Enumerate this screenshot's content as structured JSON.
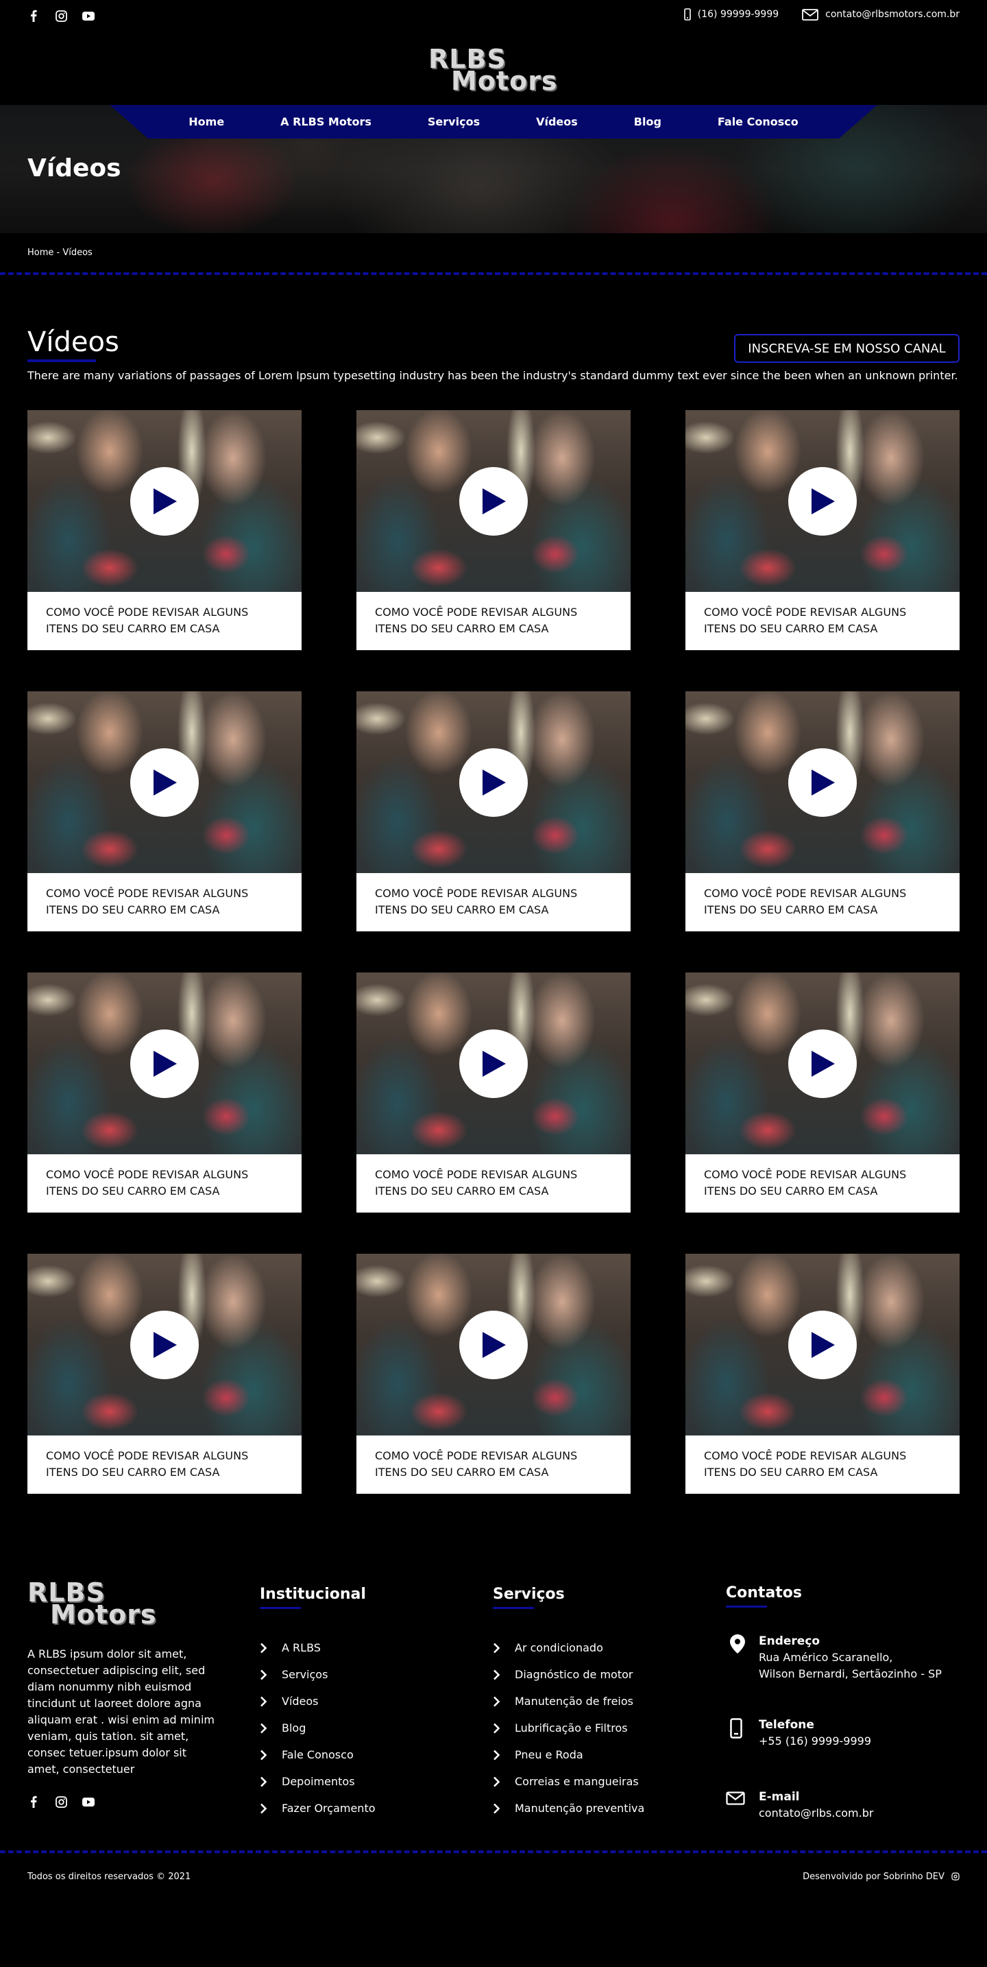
{
  "topbar": {
    "phone": "(16) 99999-9999",
    "email": "contato@rlbsmotors.com.br",
    "social_icons": [
      "facebook-icon",
      "instagram-icon",
      "youtube-icon"
    ]
  },
  "brand": {
    "line1": "RLBS",
    "line2": "Motors"
  },
  "nav": [
    "Home",
    "A RLBS Motors",
    "Serviços",
    "Vídeos",
    "Blog",
    "Fale Conosco"
  ],
  "hero": {
    "title": "Vídeos"
  },
  "breadcrumb": "Home - Vídeos",
  "section": {
    "title": "Vídeos",
    "subscribe_label": "INSCREVA-SE EM NOSSO CANAL",
    "intro": "There are many variations of passages of Lorem Ipsum typesetting industry has been the industry's standard dummy text ever since the been when an unknown printer."
  },
  "videos": [
    {
      "title": "COMO VOCÊ PODE REVISAR ALGUNS ITENS DO SEU CARRO EM CASA"
    },
    {
      "title": "COMO VOCÊ PODE REVISAR ALGUNS ITENS DO SEU CARRO EM CASA"
    },
    {
      "title": "COMO VOCÊ PODE REVISAR ALGUNS ITENS DO SEU CARRO EM CASA"
    },
    {
      "title": "COMO VOCÊ PODE REVISAR ALGUNS ITENS DO SEU CARRO EM CASA"
    },
    {
      "title": "COMO VOCÊ PODE REVISAR ALGUNS ITENS DO SEU CARRO EM CASA"
    },
    {
      "title": "COMO VOCÊ PODE REVISAR ALGUNS ITENS DO SEU CARRO EM CASA"
    },
    {
      "title": "COMO VOCÊ PODE REVISAR ALGUNS ITENS DO SEU CARRO EM CASA"
    },
    {
      "title": "COMO VOCÊ PODE REVISAR ALGUNS ITENS DO SEU CARRO EM CASA"
    },
    {
      "title": "COMO VOCÊ PODE REVISAR ALGUNS ITENS DO SEU CARRO EM CASA"
    },
    {
      "title": "COMO VOCÊ PODE REVISAR ALGUNS ITENS DO SEU CARRO EM CASA"
    },
    {
      "title": "COMO VOCÊ PODE REVISAR ALGUNS ITENS DO SEU CARRO EM CASA"
    },
    {
      "title": "COMO VOCÊ PODE REVISAR ALGUNS ITENS DO SEU CARRO EM CASA"
    }
  ],
  "footer": {
    "about": "A RLBS ipsum dolor sit amet, consectetuer adipiscing elit, sed diam nonummy nibh euismod tincidunt ut laoreet dolore agna aliquam erat . wisi enim ad minim veniam, quis tation. sit amet, consec tetuer.ipsum dolor sit amet, consectetuer",
    "institucional": {
      "title": "Institucional",
      "items": [
        "A RLBS",
        "Serviços",
        "Vídeos",
        "Blog",
        "Fale Conosco",
        "Depoimentos",
        "Fazer Orçamento"
      ]
    },
    "servicos": {
      "title": "Serviços",
      "items": [
        "Ar condicionado",
        "Diagnóstico de motor",
        "Manutenção de freios",
        "Lubrificação e Filtros",
        "Pneu e Roda",
        "Correias e mangueiras",
        "Manutenção preventiva"
      ]
    },
    "contatos": {
      "title": "Contatos",
      "address_label": "Endereço",
      "address_line1": "Rua Américo Scaranello,",
      "address_line2": "Wilson Bernardi, Sertãozinho - SP",
      "phone_label": "Telefone",
      "phone": "+55 (16) 9999-9999",
      "email_label": "E-mail",
      "email": "contato@rlbs.com.br"
    },
    "copyright": "Todos os direitos reservados © 2021",
    "developer": "Desenvolvido por Sobrinho DEV"
  },
  "colors": {
    "accent": "#05086b",
    "accent_bright": "#1b22c8",
    "background": "#000000"
  }
}
